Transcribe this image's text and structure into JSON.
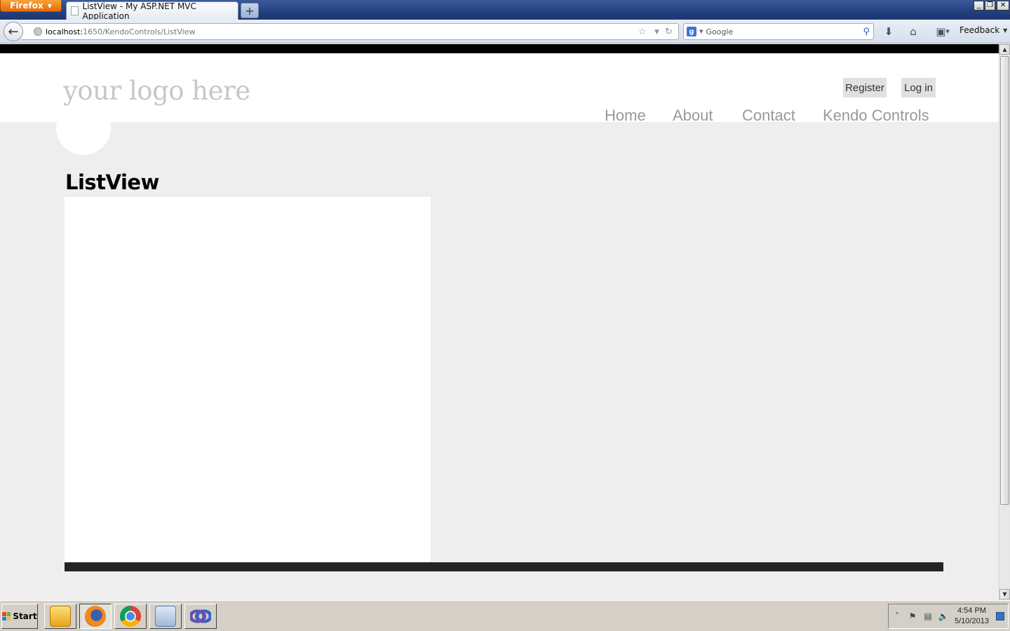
{
  "browser": {
    "menu_button": "Firefox",
    "tab_title": "ListView - My ASP.NET MVC Application",
    "new_tab": "+",
    "url_host": "localhost:",
    "url_path": "1650/KendoControls/ListView",
    "search_placeholder": "Google",
    "search_engine_icon": "google-icon",
    "feedback": "Feedback"
  },
  "window_controls": [
    "minimize",
    "restore",
    "close"
  ],
  "site": {
    "logo": "your logo here",
    "login_links": {
      "register": "Register",
      "login": "Log in"
    },
    "menu": {
      "home": "Home",
      "about": "About",
      "contact": "Contact",
      "kendo": "Kendo Controls"
    },
    "page_title": "ListView"
  },
  "taskbar": {
    "start": "Start",
    "apps": [
      "outlook-icon",
      "firefox-icon",
      "chrome-icon",
      "lync-icon",
      "visual-studio-icon"
    ],
    "time": "4:54 PM",
    "date": "5/10/2013"
  },
  "colors": {
    "topbar": "#000000",
    "page_background": "#efeeef",
    "menu_text": "#999999",
    "login_link_bg": "#e1e1e1",
    "footer_bar": "#242424",
    "firefox_orange": "#e56b05"
  }
}
